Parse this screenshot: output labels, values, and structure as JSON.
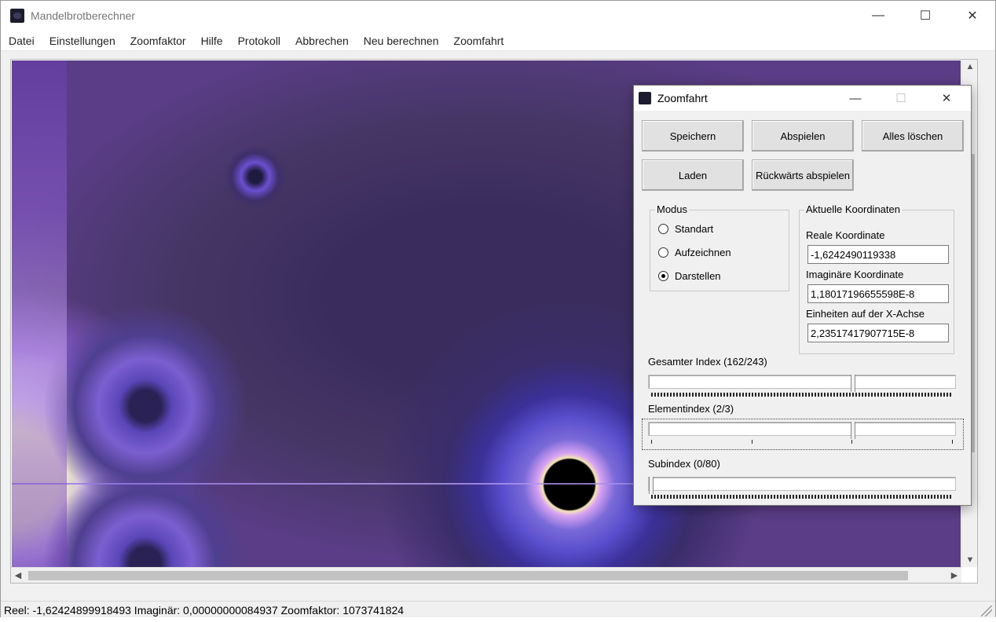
{
  "window": {
    "title": "Mandelbrotberechner",
    "minimize": "—",
    "maximize": "☐",
    "close": "✕"
  },
  "menu": [
    "Datei",
    "Einstellungen",
    "Zoomfaktor",
    "Hilfe",
    "Protokoll",
    "Abbrechen",
    "Neu berechnen",
    "Zoomfahrt"
  ],
  "canvas": {
    "scroll_up": "▲",
    "scroll_down": "▼",
    "scroll_left": "◀",
    "scroll_right": "▶"
  },
  "status": {
    "text": "Reel: -1,62424899918493 Imaginär: 0,00000000084937 Zoomfaktor: 1073741824"
  },
  "dialog": {
    "title": "Zoomfahrt",
    "minimize": "—",
    "maximize": "☐",
    "close": "✕",
    "buttons": {
      "save": "Speichern",
      "play": "Abspielen",
      "clear_all": "Alles löschen",
      "load": "Laden",
      "play_reverse": "Rückwärts abspielen"
    },
    "mode": {
      "label": "Modus",
      "options": [
        "Standart",
        "Aufzeichnen",
        "Darstellen"
      ],
      "selected": "Darstellen"
    },
    "coordinates": {
      "label": "Aktuelle Koordinaten",
      "real_label": "Reale Koordinate",
      "real_value": "-1,6242490119338",
      "imag_label": "Imaginäre Koordinate",
      "imag_value": "1,18017196655598E-8",
      "units_label": "Einheiten auf der X-Achse",
      "units_value": "2,23517417907715E-8"
    },
    "sliders": {
      "total_index": {
        "label": "Gesamter Index (162/243)",
        "value": 162,
        "max": 243
      },
      "element_index": {
        "label": "Elementindex (2/3)",
        "value": 2,
        "max": 3
      },
      "sub_index": {
        "label": "Subindex (0/80)",
        "value": 0,
        "max": 80
      }
    }
  }
}
